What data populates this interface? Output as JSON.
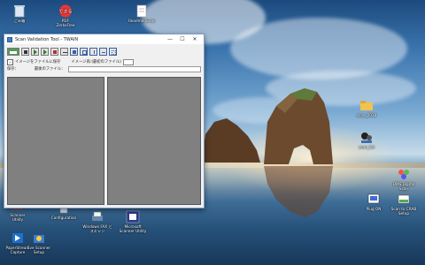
{
  "window": {
    "title": "Scan Validation Tool - TWAIN",
    "controls": [
      "—",
      "☐",
      "✕"
    ],
    "toolbar_icons": [
      "scan-icon",
      "stop-icon",
      "play-icon",
      "step-icon",
      "record-icon",
      "minus-icon",
      "x-box-icon",
      "frame-icon",
      "split-vertical-icon",
      "split-horizontal-icon",
      "grid-icon"
    ],
    "option1_label": "イメージをファイルに保存",
    "option1_checked": "✓",
    "option2_label": "イメージ再:(最初のファイル)",
    "folder_label": "保存：",
    "file_label": "最後のファイル："
  },
  "desktop_icons": [
    {
      "label": "ごみ箱",
      "icon": "recycle-bin-icon"
    },
    {
      "label": "PDF\nZerkeFree",
      "icon": "pdf-app-icon"
    },
    {
      "label": "ReadmeRE.txt",
      "icon": "text-file-icon"
    },
    {
      "label": "scan_2018",
      "icon": "folder-icon"
    },
    {
      "label": "scan_list",
      "icon": "scanner-app-icon"
    },
    {
      "label": "Scanner\nUtility",
      "icon": "scanner-icon"
    },
    {
      "label": "Configuration",
      "icon": "config-icon"
    },
    {
      "label": "Windows FAX と\nスキャン",
      "icon": "fax-scan-icon"
    },
    {
      "label": "Microsoft\nScanner Utility",
      "icon": "ms-scanner-icon"
    },
    {
      "label": "PaperStream\nCapture",
      "icon": "capture-icon"
    },
    {
      "label": "Plug ON",
      "icon": "plug-icon"
    },
    {
      "label": "DMS Digital\nScan",
      "icon": "dms-icon"
    },
    {
      "label": "Eve Scanner\nSetup",
      "icon": "setup-icon"
    },
    {
      "label": "Scan to CRAB\nSetup",
      "icon": "scan-setup-icon"
    }
  ],
  "colors": {
    "accent": "#4a7bc0",
    "pane": "#808080"
  }
}
